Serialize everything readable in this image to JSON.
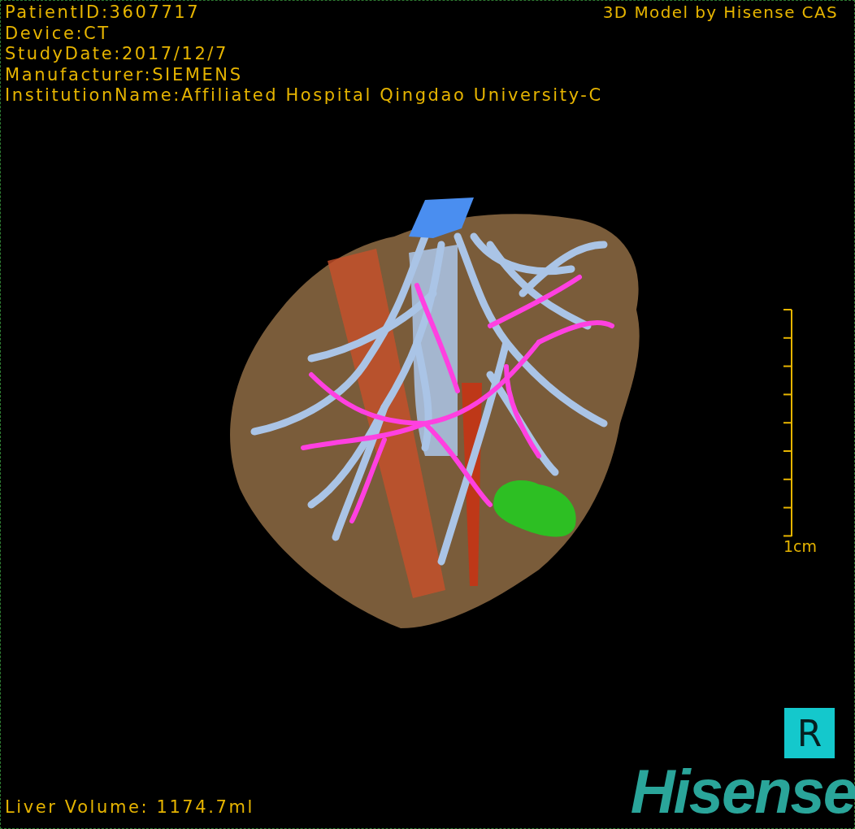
{
  "info_lines": [
    "PatientID:3607717",
    "Device:CT",
    "StudyDate:2017/12/7",
    "Manufacturer:SIEMENS",
    "InstitutionName:Affiliated Hospital Qingdao University-C"
  ],
  "model_credit": "3D Model by Hisense CAS",
  "scale": {
    "label": "1cm"
  },
  "liver_volume": "Liver Volume: 1174.7ml",
  "orientation_marker": "R",
  "logo": "Hisense"
}
